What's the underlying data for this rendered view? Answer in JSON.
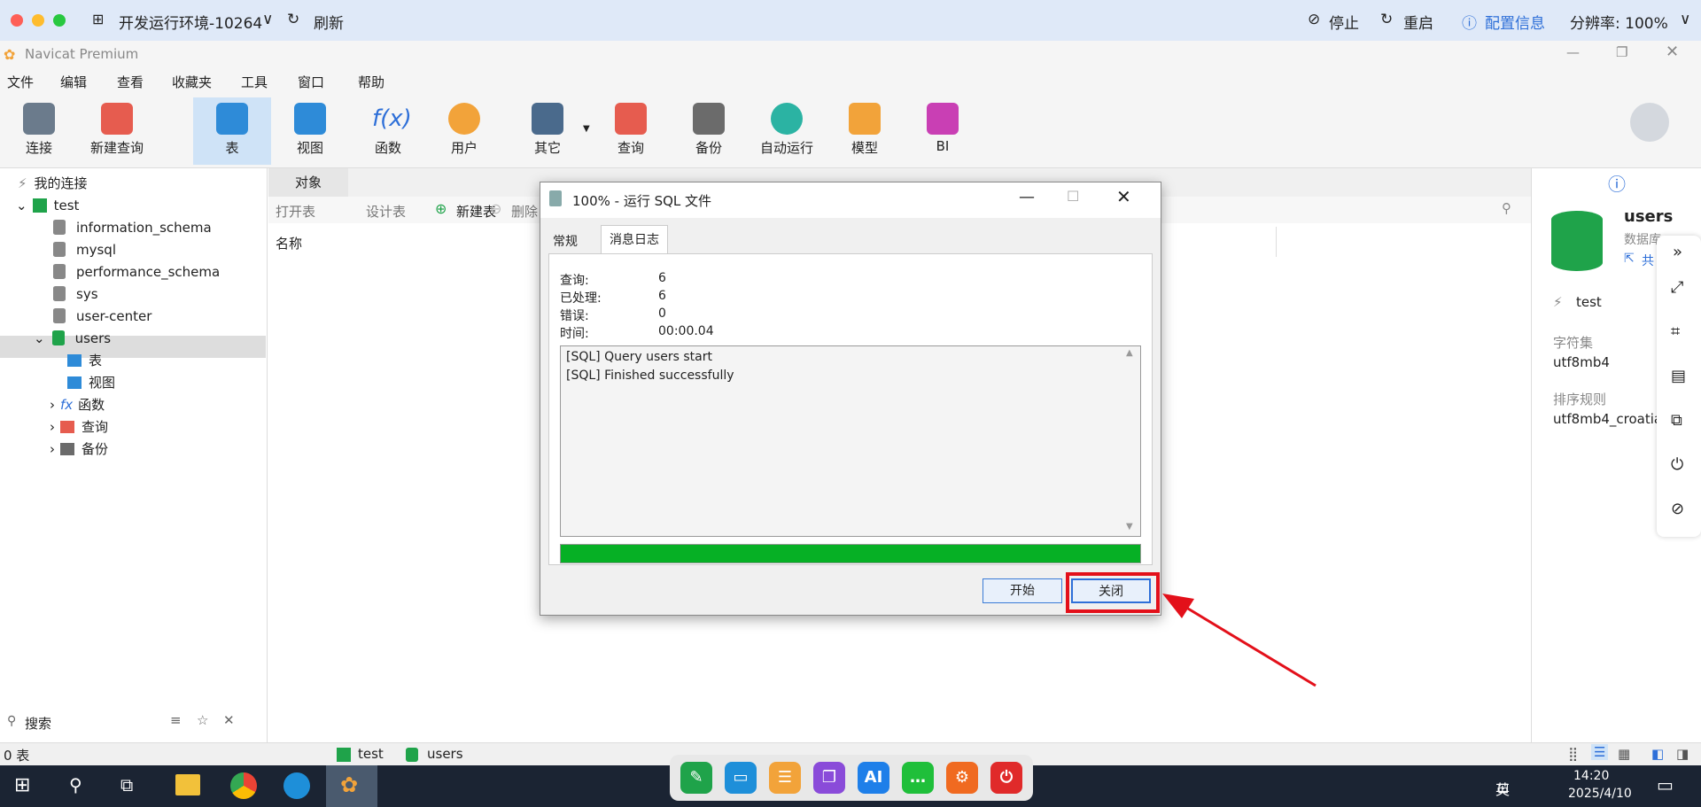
{
  "remote_bar": {
    "env_label": "开发运行环境-10264",
    "refresh_label": "刷新",
    "stop_label": "停止",
    "restart_label": "重启",
    "config_label": "配置信息",
    "resolution_label": "分辨率: 100%"
  },
  "app": {
    "title": "Navicat Premium"
  },
  "menu": [
    "文件",
    "编辑",
    "查看",
    "收藏夹",
    "工具",
    "窗口",
    "帮助"
  ],
  "toolbar": [
    {
      "label": "连接",
      "color": "#6b7b8c"
    },
    {
      "label": "新建查询",
      "color": "#e65c4f"
    },
    {
      "label": "表",
      "color": "#2e8bd8"
    },
    {
      "label": "视图",
      "color": "#2e8bd8"
    },
    {
      "label": "函数",
      "color": "#2e6fd8"
    },
    {
      "label": "用户",
      "color": "#f2a33a"
    },
    {
      "label": "其它",
      "color": "#4a6a8c"
    },
    {
      "label": "查询",
      "color": "#e65c4f"
    },
    {
      "label": "备份",
      "color": "#6b6b6b"
    },
    {
      "label": "自动运行",
      "color": "#2bb3a3"
    },
    {
      "label": "模型",
      "color": "#f2a33a"
    },
    {
      "label": "BI",
      "color": "#c93fb4"
    }
  ],
  "tree": {
    "root": "我的连接",
    "connection": "test",
    "databases": [
      "information_schema",
      "mysql",
      "performance_schema",
      "sys",
      "user-center",
      "users"
    ],
    "children": [
      "表",
      "视图",
      "函数",
      "查询",
      "备份"
    ]
  },
  "search_placeholder": "搜索",
  "object": {
    "tab": "对象",
    "actions": [
      "打开表",
      "设计表",
      "新建表",
      "删除"
    ],
    "column_header": "名称"
  },
  "right_panel": {
    "db_name": "users",
    "db_type": "数据库",
    "share_label": "共",
    "connection": "test",
    "charset_label": "字符集",
    "charset_value": "utf8mb4",
    "collation_label": "排序规则",
    "collation_value": "utf8mb4_croatia"
  },
  "status": {
    "count": "0 表",
    "connection": "test",
    "database": "users"
  },
  "taskbar": {
    "time": "14:20",
    "date": "2025/4/10",
    "ime": "英"
  },
  "dialog": {
    "title": "100% - 运行 SQL 文件",
    "tabs": [
      "常规",
      "消息日志"
    ],
    "stats": [
      {
        "label": "查询:",
        "value": "6"
      },
      {
        "label": "已处理:",
        "value": "6"
      },
      {
        "label": "错误:",
        "value": "0"
      },
      {
        "label": "时间:",
        "value": "00:00.04"
      }
    ],
    "log": [
      "[SQL] Query users start",
      "[SQL] Finished successfully"
    ],
    "progress": 1.0,
    "start_label": "开始",
    "close_label": "关闭"
  }
}
